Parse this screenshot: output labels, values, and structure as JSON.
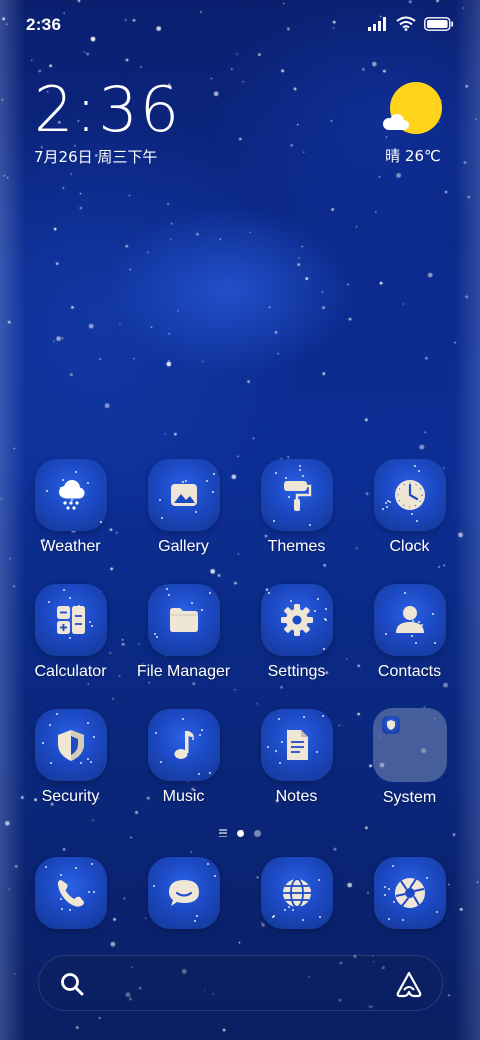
{
  "status_bar": {
    "time": "2:36",
    "battery_level": 0.9
  },
  "clock_widget": {
    "time": "2:36",
    "date": "7月26日 周三下午"
  },
  "weather_widget": {
    "text": "晴 26℃",
    "sun_color": "#ffd31a"
  },
  "apps": [
    {
      "label": "Weather",
      "icon": "weather-cloud-snow-icon"
    },
    {
      "label": "Gallery",
      "icon": "gallery-image-icon"
    },
    {
      "label": "Themes",
      "icon": "paint-roller-icon"
    },
    {
      "label": "Clock",
      "icon": "clock-icon"
    },
    {
      "label": "Calculator",
      "icon": "calculator-icon"
    },
    {
      "label": "File Manager",
      "icon": "folder-icon"
    },
    {
      "label": "Settings",
      "icon": "gear-icon"
    },
    {
      "label": "Contacts",
      "icon": "person-icon"
    },
    {
      "label": "Security",
      "icon": "shield-icon"
    },
    {
      "label": "Music",
      "icon": "music-note-icon"
    },
    {
      "label": "Notes",
      "icon": "document-icon"
    },
    {
      "label": "System",
      "icon": "folder-group-icon"
    }
  ],
  "page_indicator": {
    "pages": 2,
    "active_page": 1
  },
  "dock": [
    {
      "icon": "phone-icon"
    },
    {
      "icon": "message-bubble-icon"
    },
    {
      "icon": "globe-icon"
    },
    {
      "icon": "camera-aperture-icon"
    }
  ],
  "search_bar": {
    "left_icon": "search-icon",
    "right_icon": "assistant-icon"
  },
  "colors": {
    "icon_bg": "#1c49c4",
    "accent_sun": "#ffd31a",
    "background": "#0c2a8c"
  }
}
